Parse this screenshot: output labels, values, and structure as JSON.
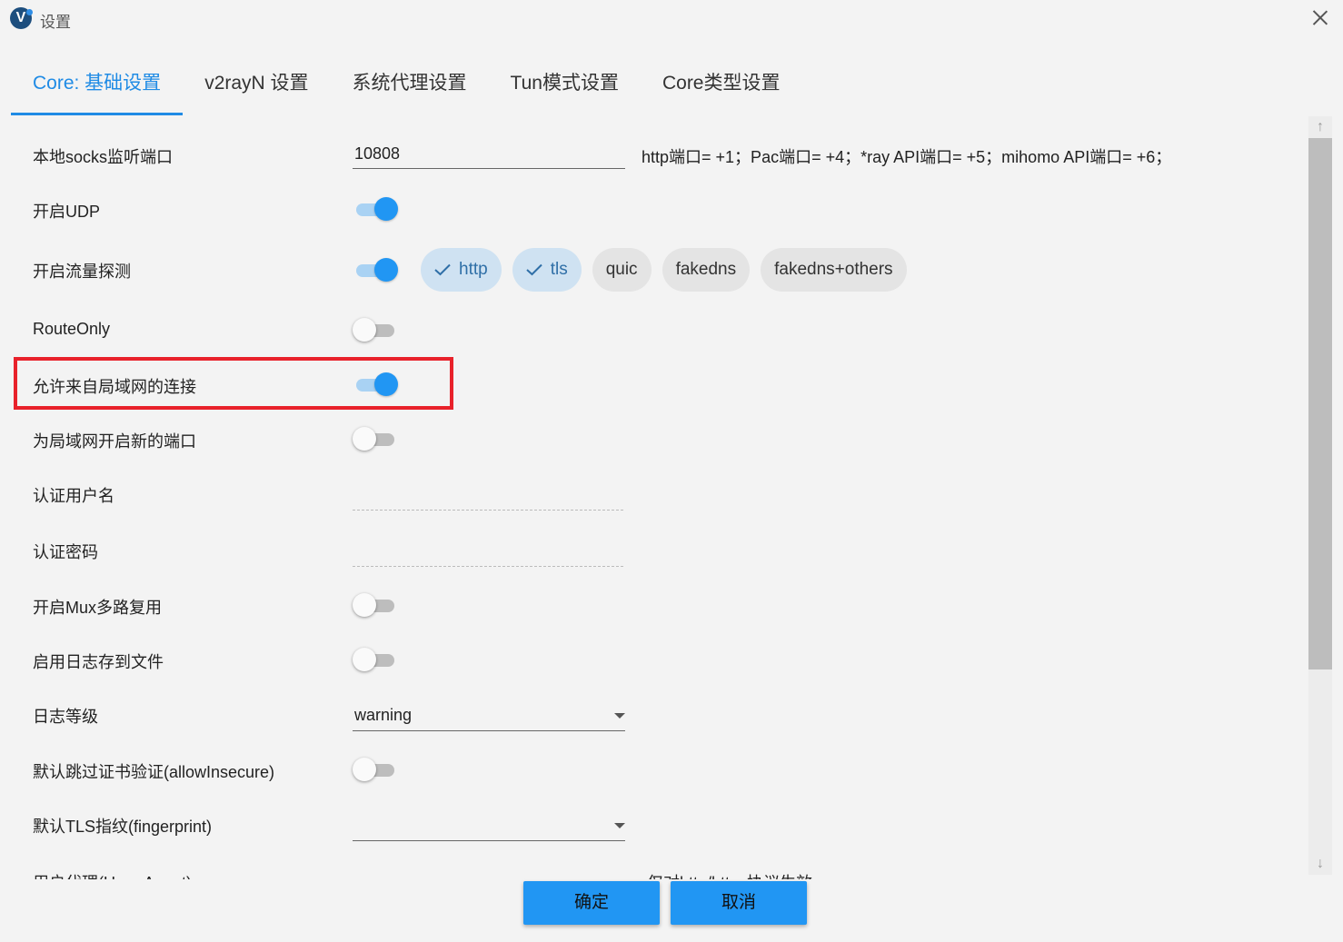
{
  "window": {
    "title": "设置",
    "app_icon_letter": "V"
  },
  "tabs": [
    {
      "label": "Core: 基础设置",
      "active": true
    },
    {
      "label": "v2rayN 设置",
      "active": false
    },
    {
      "label": "系统代理设置",
      "active": false
    },
    {
      "label": "Tun模式设置",
      "active": false
    },
    {
      "label": "Core类型设置",
      "active": false
    }
  ],
  "settings": {
    "socks_port": {
      "label": "本地socks监听端口",
      "value": "10808",
      "hint": "http端口= +1；Pac端口= +4；*ray API端口= +5；mihomo API端口= +6；"
    },
    "udp": {
      "label": "开启UDP",
      "on": true
    },
    "sniffing": {
      "label": "开启流量探测",
      "on": true,
      "chips": [
        {
          "label": "http",
          "checked": true
        },
        {
          "label": "tls",
          "checked": true
        },
        {
          "label": "quic",
          "checked": false
        },
        {
          "label": "fakedns",
          "checked": false
        },
        {
          "label": "fakedns+others",
          "checked": false
        }
      ]
    },
    "route_only": {
      "label": "RouteOnly",
      "on": false
    },
    "allow_lan": {
      "label": "允许来自局域网的连接",
      "on": true
    },
    "lan_new_port": {
      "label": "为局域网开启新的端口",
      "on": false
    },
    "auth_user": {
      "label": "认证用户名",
      "value": ""
    },
    "auth_pass": {
      "label": "认证密码",
      "value": ""
    },
    "mux": {
      "label": "开启Mux多路复用",
      "on": false
    },
    "log_to_file": {
      "label": "启用日志存到文件",
      "on": false
    },
    "log_level": {
      "label": "日志等级",
      "value": "warning"
    },
    "allow_insecure": {
      "label": "默认跳过证书验证(allowInsecure)",
      "on": false
    },
    "fingerprint": {
      "label": "默认TLS指纹(fingerprint)",
      "value": ""
    },
    "partial_row": {
      "label": "用户代理(User-Agent)",
      "hint": "仅对http/https协议生效"
    }
  },
  "buttons": {
    "ok": "确定",
    "cancel": "取消"
  },
  "colors": {
    "accent": "#2196f3",
    "highlight": "#e8212a"
  }
}
